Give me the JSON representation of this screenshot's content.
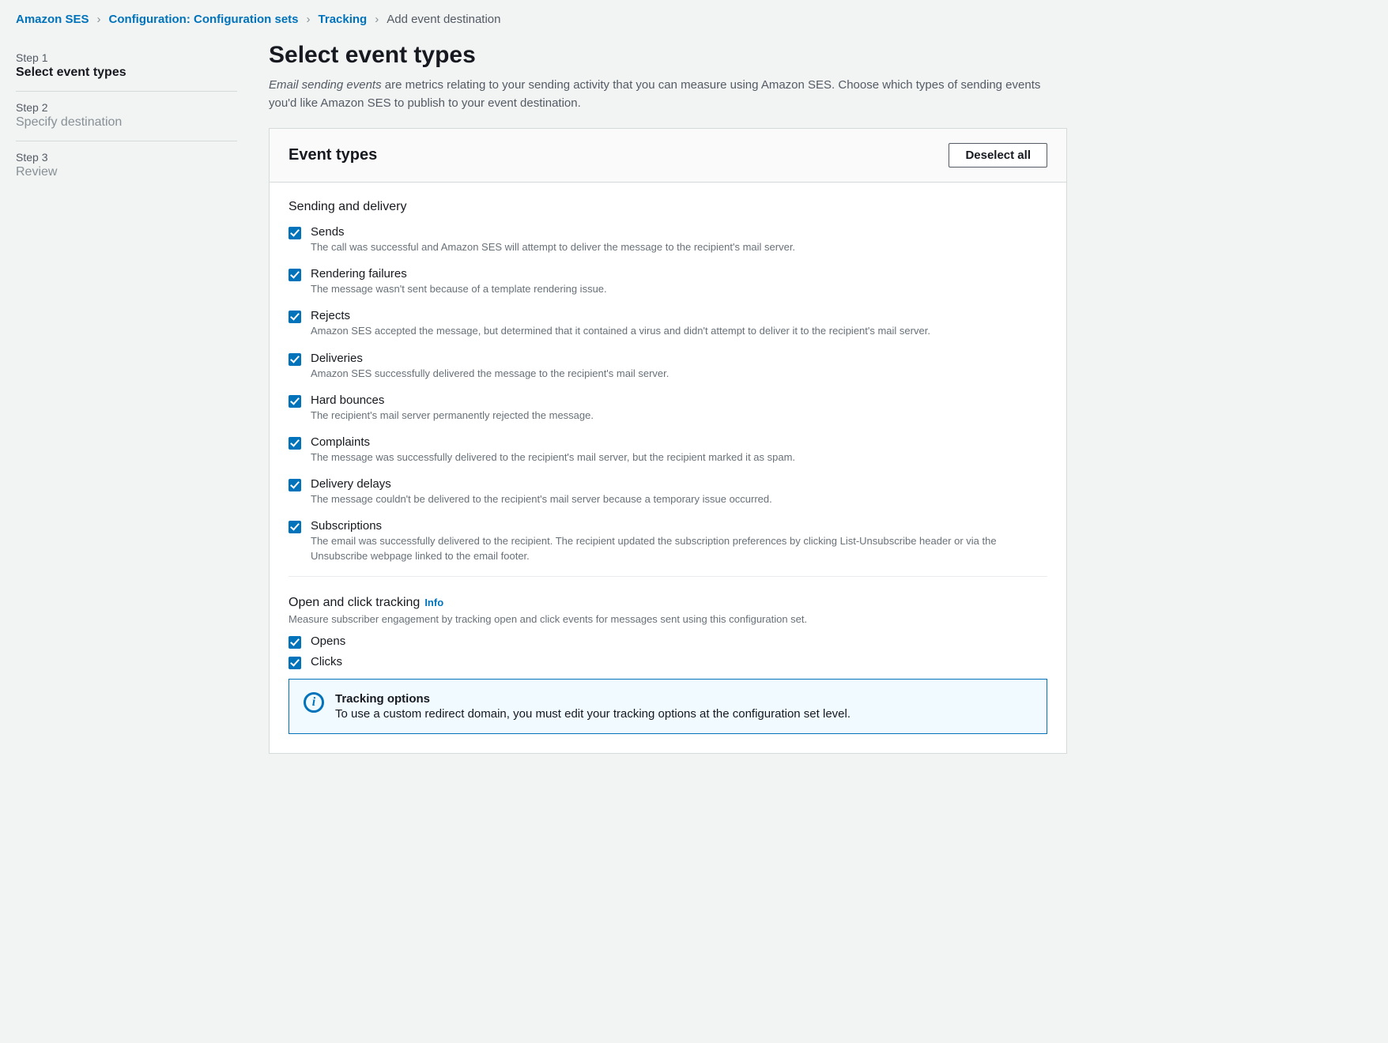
{
  "breadcrumbs": {
    "items": [
      "Amazon SES",
      "Configuration: Configuration sets",
      "Tracking"
    ],
    "current": "Add event destination"
  },
  "steps": [
    {
      "label": "Step 1",
      "title": "Select event types",
      "active": true
    },
    {
      "label": "Step 2",
      "title": "Specify destination",
      "active": false
    },
    {
      "label": "Step 3",
      "title": "Review",
      "active": false
    }
  ],
  "page": {
    "heading": "Select event types",
    "intro_em": "Email sending events",
    "intro_rest": " are metrics relating to your sending activity that you can measure using Amazon SES. Choose which types of sending events you'd like Amazon SES to publish to your event destination."
  },
  "panel": {
    "title": "Event types",
    "deselect_label": "Deselect all"
  },
  "group1": {
    "heading": "Sending and delivery",
    "items": [
      {
        "label": "Sends",
        "desc": "The call was successful and Amazon SES will attempt to deliver the message to the recipient's mail server."
      },
      {
        "label": "Rendering failures",
        "desc": "The message wasn't sent because of a template rendering issue."
      },
      {
        "label": "Rejects",
        "desc": "Amazon SES accepted the message, but determined that it contained a virus and didn't attempt to deliver it to the recipient's mail server."
      },
      {
        "label": "Deliveries",
        "desc": "Amazon SES successfully delivered the message to the recipient's mail server."
      },
      {
        "label": "Hard bounces",
        "desc": "The recipient's mail server permanently rejected the message."
      },
      {
        "label": "Complaints",
        "desc": "The message was successfully delivered to the recipient's mail server, but the recipient marked it as spam."
      },
      {
        "label": "Delivery delays",
        "desc": "The message couldn't be delivered to the recipient's mail server because a temporary issue occurred."
      },
      {
        "label": "Subscriptions",
        "desc": "The email was successfully delivered to the recipient. The recipient updated the subscription preferences by clicking List-Unsubscribe header or via the Unsubscribe webpage linked to the email footer."
      }
    ]
  },
  "group2": {
    "heading": "Open and click tracking",
    "info_link": "Info",
    "desc": "Measure subscriber engagement by tracking open and click events for messages sent using this configuration set.",
    "items": [
      {
        "label": "Opens"
      },
      {
        "label": "Clicks"
      }
    ]
  },
  "infobox": {
    "title": "Tracking options",
    "body": "To use a custom redirect domain, you must edit your tracking options at the configuration set level."
  }
}
